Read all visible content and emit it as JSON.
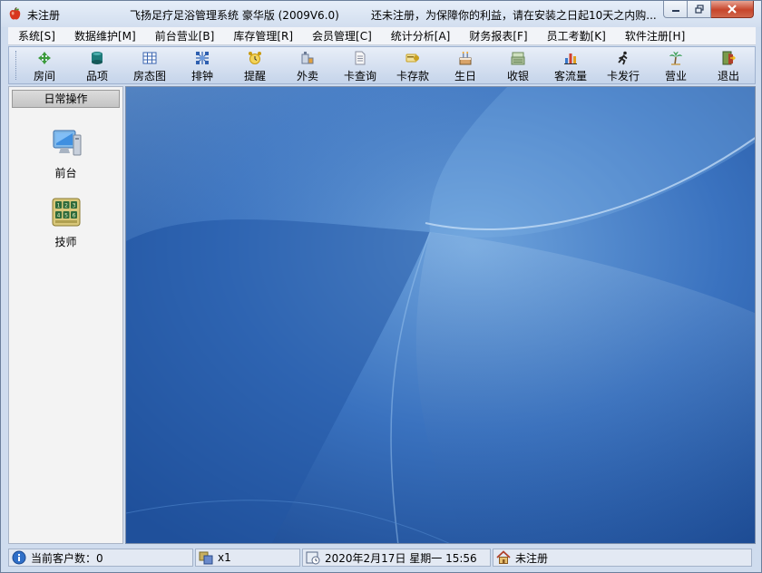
{
  "titlebar": {
    "main_title": "未注册",
    "system_title": "飞扬足疗足浴管理系统  豪华版 (2009V6.0)",
    "notice": "还未注册，为保障你的利益，请在安装之日起10天之内购...",
    "icon": "apple-icon"
  },
  "menu": {
    "items": [
      {
        "label": "系统[S]"
      },
      {
        "label": "数据维护[M]"
      },
      {
        "label": "前台营业[B]"
      },
      {
        "label": "库存管理[R]"
      },
      {
        "label": "会员管理[C]"
      },
      {
        "label": "统计分析[A]"
      },
      {
        "label": "财务报表[F]"
      },
      {
        "label": "员工考勤[K]"
      },
      {
        "label": "软件注册[H]"
      }
    ]
  },
  "toolbar": {
    "buttons": [
      {
        "label": "房间",
        "icon": "room-icon",
        "color": "#3b9b3b"
      },
      {
        "label": "品项",
        "icon": "database-icon",
        "color": "#1e7a7a"
      },
      {
        "label": "房态图",
        "icon": "grid-icon",
        "color": "#3a64b0"
      },
      {
        "label": "排钟",
        "icon": "network-icon",
        "color": "#2e5fb0"
      },
      {
        "label": "提醒",
        "icon": "alarm-icon",
        "color": "#c89a10"
      },
      {
        "label": "外卖",
        "icon": "box-icon",
        "color": "#6a7a96"
      },
      {
        "label": "卡查询",
        "icon": "document-icon",
        "color": "#8a8fa0"
      },
      {
        "label": "卡存款",
        "icon": "card-icon",
        "color": "#c8a020"
      },
      {
        "label": "生日",
        "icon": "cake-icon",
        "color": "#7a8aa8"
      },
      {
        "label": "收银",
        "icon": "register-icon",
        "color": "#6b8a5a"
      },
      {
        "label": "客流量",
        "icon": "bar-chart-icon",
        "color": "#d04030"
      },
      {
        "label": "卡发行",
        "icon": "runner-icon",
        "color": "#222222"
      },
      {
        "label": "营业",
        "icon": "palm-icon",
        "color": "#2f9a4a"
      },
      {
        "label": "退出",
        "icon": "exit-door-icon",
        "color": "#b0402a"
      }
    ]
  },
  "leftpanel": {
    "header": "日常操作",
    "items": [
      {
        "label": "前台",
        "icon": "computer-icon"
      },
      {
        "label": "技师",
        "icon": "numpad-icon"
      }
    ]
  },
  "statusbar": {
    "customers_label": "当前客户数：0",
    "multiplier": "x1",
    "datetime": "2020年2月17日    星期一     15:56",
    "registration": "未注册"
  },
  "colors": {
    "desktop_blue": "#2b5ca7",
    "titlebar": "#dce6f4",
    "close_red": "#c7452b"
  }
}
